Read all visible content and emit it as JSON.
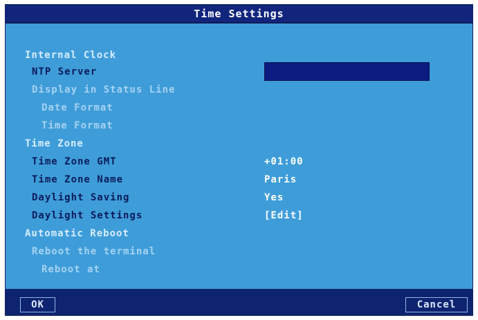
{
  "window": {
    "title": "Time Settings"
  },
  "sections": {
    "internal_clock": {
      "label": "Internal Clock",
      "ntp_server": {
        "label": "NTP Server",
        "value": ""
      },
      "display_status_line": {
        "label": "Display in Status Line"
      },
      "date_format": {
        "label": "Date Format"
      },
      "time_format": {
        "label": "Time Format"
      }
    },
    "time_zone": {
      "label": "Time Zone",
      "gmt": {
        "label": "Time Zone GMT",
        "value": "+01:00"
      },
      "name": {
        "label": "Time Zone Name",
        "value": "Paris"
      },
      "daylight_saving": {
        "label": "Daylight Saving",
        "value": "Yes"
      },
      "daylight_settings": {
        "label": "Daylight Settings",
        "value": "[Edit]"
      }
    },
    "automatic_reboot": {
      "label": "Automatic Reboot",
      "reboot_terminal": {
        "label": "Reboot the terminal"
      },
      "reboot_at": {
        "label": "Reboot at"
      }
    }
  },
  "footer": {
    "ok_label": "OK",
    "cancel_label": "Cancel"
  },
  "colors": {
    "title_bar": "#11257c",
    "panel": "#3e9dd9",
    "footer": "#0f2470",
    "active_label": "#0a1b5a",
    "muted_label": "#a7d2f2",
    "field": "#0c1b80"
  }
}
